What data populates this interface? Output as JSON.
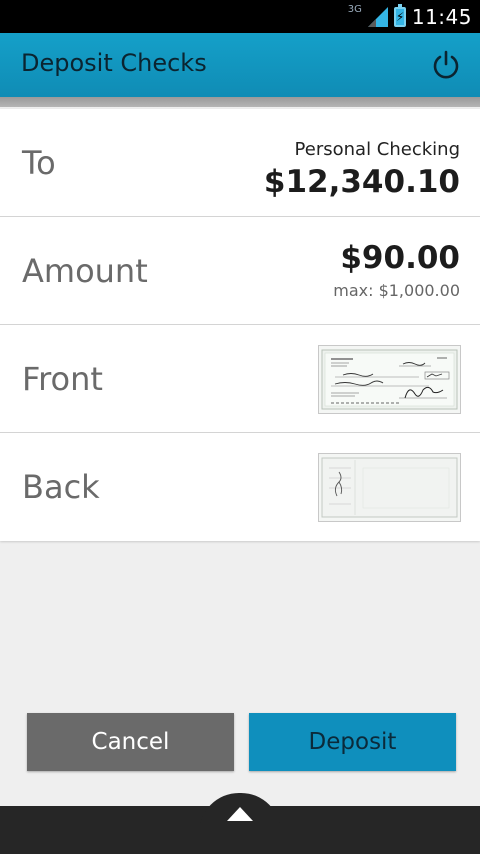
{
  "status_bar": {
    "network": "3G",
    "time": "11:45"
  },
  "header": {
    "title": "Deposit Checks",
    "power_icon": "power-icon"
  },
  "rows": {
    "to": {
      "label": "To",
      "account_name": "Personal Checking",
      "balance": "$12,340.10"
    },
    "amount": {
      "label": "Amount",
      "value": "$90.00",
      "max": "max: $1,000.00"
    },
    "front": {
      "label": "Front",
      "thumb_icon": "check-front-image"
    },
    "back": {
      "label": "Back",
      "thumb_icon": "check-back-image"
    }
  },
  "actions": {
    "cancel_label": "Cancel",
    "deposit_label": "Deposit"
  },
  "colors": {
    "accent": "#0f8fbd",
    "cancel": "#6a6a6a"
  }
}
